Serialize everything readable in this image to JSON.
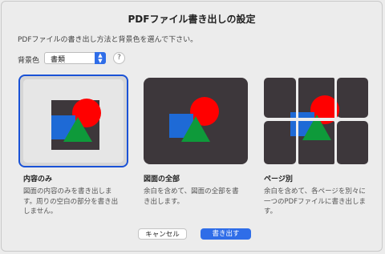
{
  "dialog": {
    "title": "PDFファイル書き出しの設定",
    "description": "PDFファイルの書き出し方法と背景色を選んで下さい。"
  },
  "background": {
    "label": "背景色",
    "selected": "書類",
    "help": "?"
  },
  "options": [
    {
      "title": "内容のみ",
      "description": "図面の内容のみを書き出します。周りの空白の部分を書き出しません。",
      "selected": true
    },
    {
      "title": "図面の全部",
      "description": "余白を含めて、図面の全部を書き出します。",
      "selected": false
    },
    {
      "title": "ページ別",
      "description": "余白を含めて、各ページを別々に一つのPDFファイルに書き出します。",
      "selected": false
    }
  ],
  "buttons": {
    "cancel": "キャンセル",
    "export": "書き出す"
  },
  "colors": {
    "accent": "#2f6de8",
    "shape_red": "#ff0000",
    "shape_blue": "#1e6ad6",
    "shape_green": "#0e9a3a",
    "dark_bg": "#3d373b"
  }
}
